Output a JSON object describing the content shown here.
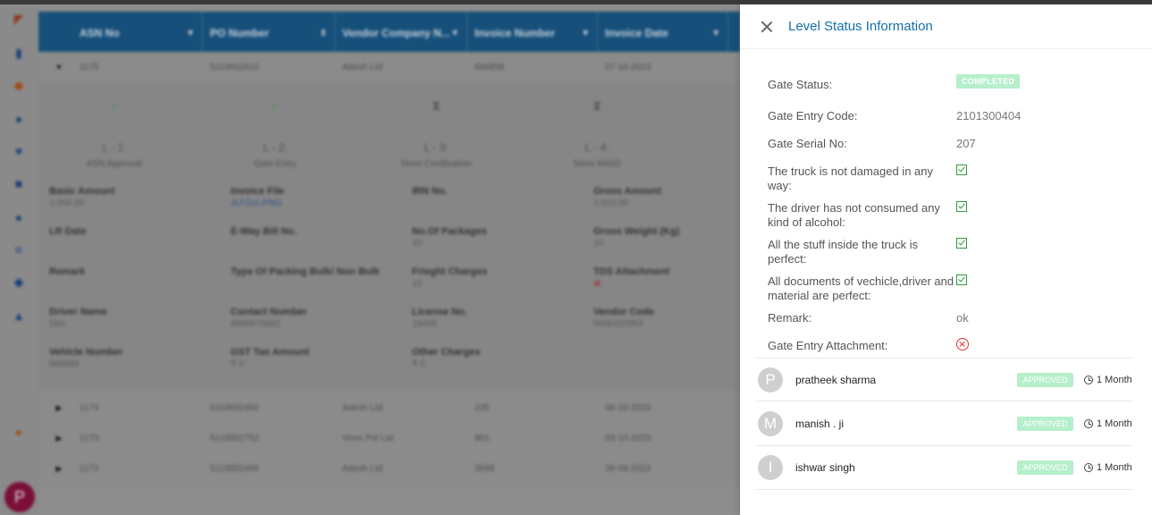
{
  "app": {
    "grid_headers": [
      "ASN No",
      "PO Number",
      "Vendor Company N...",
      "Invoice Number",
      "Invoice Date"
    ],
    "rows_top": [
      {
        "asn": "1175",
        "po": "5110002615",
        "vendor": "Adesh Ltd",
        "invoice": "696858",
        "date": "07-10-2023"
      }
    ],
    "steps": [
      {
        "level": "L - 1:",
        "name": "ASN Approval"
      },
      {
        "level": "L - 2:",
        "name": "Gate Entry"
      },
      {
        "level": "L - 3:",
        "name": "Store Certification"
      },
      {
        "level": "L - 4:",
        "name": "Store MIGO"
      }
    ],
    "fields": [
      {
        "label": "Basic Amount",
        "value": "1,000.00"
      },
      {
        "label": "Invoice File",
        "value": "JLFZcc.PNG"
      },
      {
        "label": "IRN No.",
        "value": ""
      },
      {
        "label": "Gross Amount",
        "value": "1,010.00"
      },
      {
        "label": "LR Date",
        "value": ""
      },
      {
        "label": "E-Way Bill No.",
        "value": ""
      },
      {
        "label": "No.Of Packages",
        "value": "10"
      },
      {
        "label": "Gross Weight (Kg)",
        "value": "10"
      },
      {
        "label": "Remark",
        "value": ""
      },
      {
        "label": "Type Of Packing Bulk/ Non Bulk",
        "value": ""
      },
      {
        "label": "Frieght Charges",
        "value": "10"
      },
      {
        "label": "TDS Attachment",
        "value": ""
      },
      {
        "label": "Driver Name",
        "value": "Dlm"
      },
      {
        "label": "Contact Number",
        "value": "8965875682"
      },
      {
        "label": "License No.",
        "value": "15455"
      },
      {
        "label": "Vendor Code",
        "value": "0000102953"
      },
      {
        "label": "Vehicle Number",
        "value": "568889"
      },
      {
        "label": "GST Tax Amount",
        "value": "₹ 0"
      },
      {
        "label": "Other Charges",
        "value": "₹ 0"
      }
    ],
    "rows_bottom": [
      {
        "asn": "1174",
        "po": "5110002492",
        "vendor": "Adesh Ltd",
        "invoice": "235",
        "date": "06-10-2023"
      },
      {
        "asn": "1173",
        "po": "5110002752",
        "vendor": "Viren Pvt Ltd",
        "invoice": "801",
        "date": "03-10-2023"
      },
      {
        "asn": "1172",
        "po": "5110002466",
        "vendor": "Adesh Ltd",
        "invoice": "3568",
        "date": "26-09-2023"
      }
    ],
    "user_initial": "P"
  },
  "panel": {
    "title": "Level Status Information",
    "gate_status_label": "Gate Status:",
    "gate_status_value": "COMPLETED",
    "gate_entry_code_label": "Gate Entry Code:",
    "gate_entry_code_value": "2101300404",
    "gate_serial_label": "Gate Serial No:",
    "gate_serial_value": "207",
    "check_truck_label": "The truck is not damaged in any way:",
    "check_driver_label": "The driver has not consumed any kind of alcohol:",
    "check_stuff_label": "All the stuff inside the truck is perfect:",
    "check_docs_label": "All documents of vechicle,driver and material are perfect:",
    "remark_label": "Remark:",
    "remark_value": "ok",
    "attachment_label": "Gate Entry Attachment:",
    "approvers": [
      {
        "initial": "P",
        "name": "pratheek sharma",
        "status": "APPROVED",
        "time": "1 Month"
      },
      {
        "initial": "M",
        "name": "manish . ji",
        "status": "APPROVED",
        "time": "1 Month"
      },
      {
        "initial": "I",
        "name": "ishwar singh",
        "status": "APPROVED",
        "time": "1 Month"
      }
    ]
  }
}
